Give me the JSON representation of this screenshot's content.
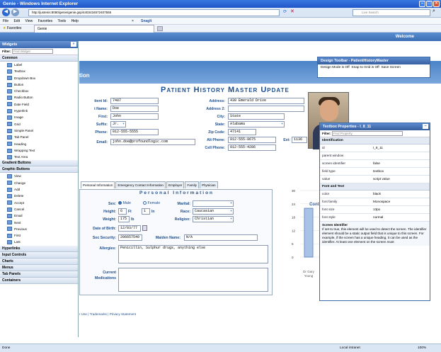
{
  "window": {
    "title": "Genie - Windows Internet Explorer"
  },
  "browser": {
    "url": "http://justenis:8080/genie/genie.gsp/4403434572407555",
    "search_placeholder": "Live Search",
    "menu": [
      "File",
      "Edit",
      "View",
      "Favorites",
      "Tools",
      "Help"
    ],
    "favorites_label": "Favorites",
    "tab_label": "Genie",
    "snagit_label": "SnagIt",
    "status_left": "Done",
    "status_zone": "Local intranet",
    "zoom": "100%"
  },
  "app": {
    "welcome": "Welcome",
    "section_title": "tion",
    "page_title": "Patient History Master Update",
    "footer_links": "r Use | Trademarks | Privacy Statement"
  },
  "widgets": {
    "title": "Widgets",
    "filter_label": "Filter:",
    "filter_placeholder": "Find Widget",
    "groups": [
      {
        "name": "Common",
        "items": [
          "Label",
          "Textbox",
          "Dropdown Box",
          "Button",
          "Checkbox",
          "Radio Button",
          "Date Field",
          "Hyperlink",
          "Image",
          "Grid",
          "Simple Panel",
          "Tab Panel",
          "Heading",
          "Wrapping Text",
          "Text Area"
        ]
      },
      {
        "name": "Gradient Buttons",
        "items": []
      },
      {
        "name": "Graphic Buttons",
        "items": [
          "View",
          "Change",
          "Add",
          "Delete",
          "Accept",
          "Cancel",
          "Email",
          "Next",
          "Previous",
          "First",
          "Last"
        ]
      },
      {
        "name": "Hyperlinks",
        "items": []
      },
      {
        "name": "Input Controls",
        "items": []
      },
      {
        "name": "Charts",
        "items": []
      },
      {
        "name": "Menus",
        "items": []
      },
      {
        "name": "Tab Panels",
        "items": []
      },
      {
        "name": "Containers",
        "items": []
      }
    ]
  },
  "form": {
    "patient_id_label": "tient Id:",
    "patient_id": "7487",
    "last_name_label": "t Name:",
    "last_name": "Doe",
    "first_label": "First:",
    "first": "John",
    "suffix_label": "Suffix:",
    "suffix": "Jr.",
    "phone_label": "Phone:",
    "phone": "012-555-5555",
    "email_label": "Email:",
    "email": "john.doe@profoundlogic.com",
    "address_label": "Address:",
    "address": "430 Emerald Drive",
    "address2_label": "Address 2:",
    "address2": "",
    "city_label": "City:",
    "city": "State",
    "state_label": "State:",
    "state": "Alabama",
    "zip_label": "Zip Code:",
    "zip": "47141",
    "alt_phone_label": "Alt Phone:",
    "alt_phone": "012-555-9675",
    "ext_label": "Ext:",
    "ext": "1136",
    "cell_label": "Cell Phone:",
    "cell": "012-555-4286"
  },
  "tabs": [
    "Personal Information",
    "Emergency Contact Information",
    "Employer",
    "Family",
    "Physician"
  ],
  "personal": {
    "header": "Personal Information",
    "sex_label": "Sex:",
    "male": "Male",
    "female": "Female",
    "marital_label": "Marital:",
    "height_label": "Height:",
    "height_ft": "6",
    "ft": "Ft",
    "height_in": "1",
    "in": "In",
    "race_label": "Race:",
    "race": "Caucasian",
    "weight_label": "Weight:",
    "weight": "175",
    "lb": "lb",
    "religion_label": "Religion:",
    "religion": "Christian",
    "dob_label": "Date of Birth:",
    "dob": "12/03/77",
    "ssn_label": "Soc Security:",
    "ssn": "206657540",
    "maiden_label": "Maiden Name:",
    "maiden": "N/A",
    "allergies_label": "Allergies:",
    "allergies": "Penicillin, Sulphur drugs, anything else",
    "current_label": "Current",
    "medications_label": "Medications"
  },
  "side": {
    "cont_label": "Cont",
    "photo_caption1": "Dr Gary",
    "photo_caption2": "Young"
  },
  "chart_data": {
    "type": "bar",
    "yticks": [
      "30",
      "24",
      "18",
      "12",
      "6",
      "0"
    ],
    "ylim": [
      0,
      30
    ],
    "values": [
      22
    ]
  },
  "design_toolbar": {
    "title": "Design Toolbar - PatientHistoryMaster",
    "items": [
      "Design Mode is Off",
      "Snap to Grid is Off",
      "Save Screen"
    ]
  },
  "properties": {
    "title": "Textbox Properties - I_8_11",
    "filter_label": "Filter:",
    "filter_placeholder": "Find Property",
    "groups": [
      {
        "name": "Identification",
        "rows": [
          [
            "id",
            "I_8_11"
          ],
          [
            "parent window",
            ""
          ],
          [
            "screen identifier",
            "false"
          ],
          [
            "field type",
            "textbox"
          ],
          [
            "value",
            "script value"
          ]
        ]
      },
      {
        "name": "Font and Text",
        "rows": [
          [
            "color",
            "black"
          ],
          [
            "font family",
            "Monospace"
          ],
          [
            "font size",
            "13px"
          ],
          [
            "font style",
            "normal"
          ]
        ]
      }
    ],
    "help_title": "Screen Identifier",
    "help_text": "If set to true, this element will be used to detect the screen. The identifier element should be a static output field that is unique to this screen. For example, if the screen has a unique heading, it can be used as the identifier. At least one element on the screen must"
  }
}
